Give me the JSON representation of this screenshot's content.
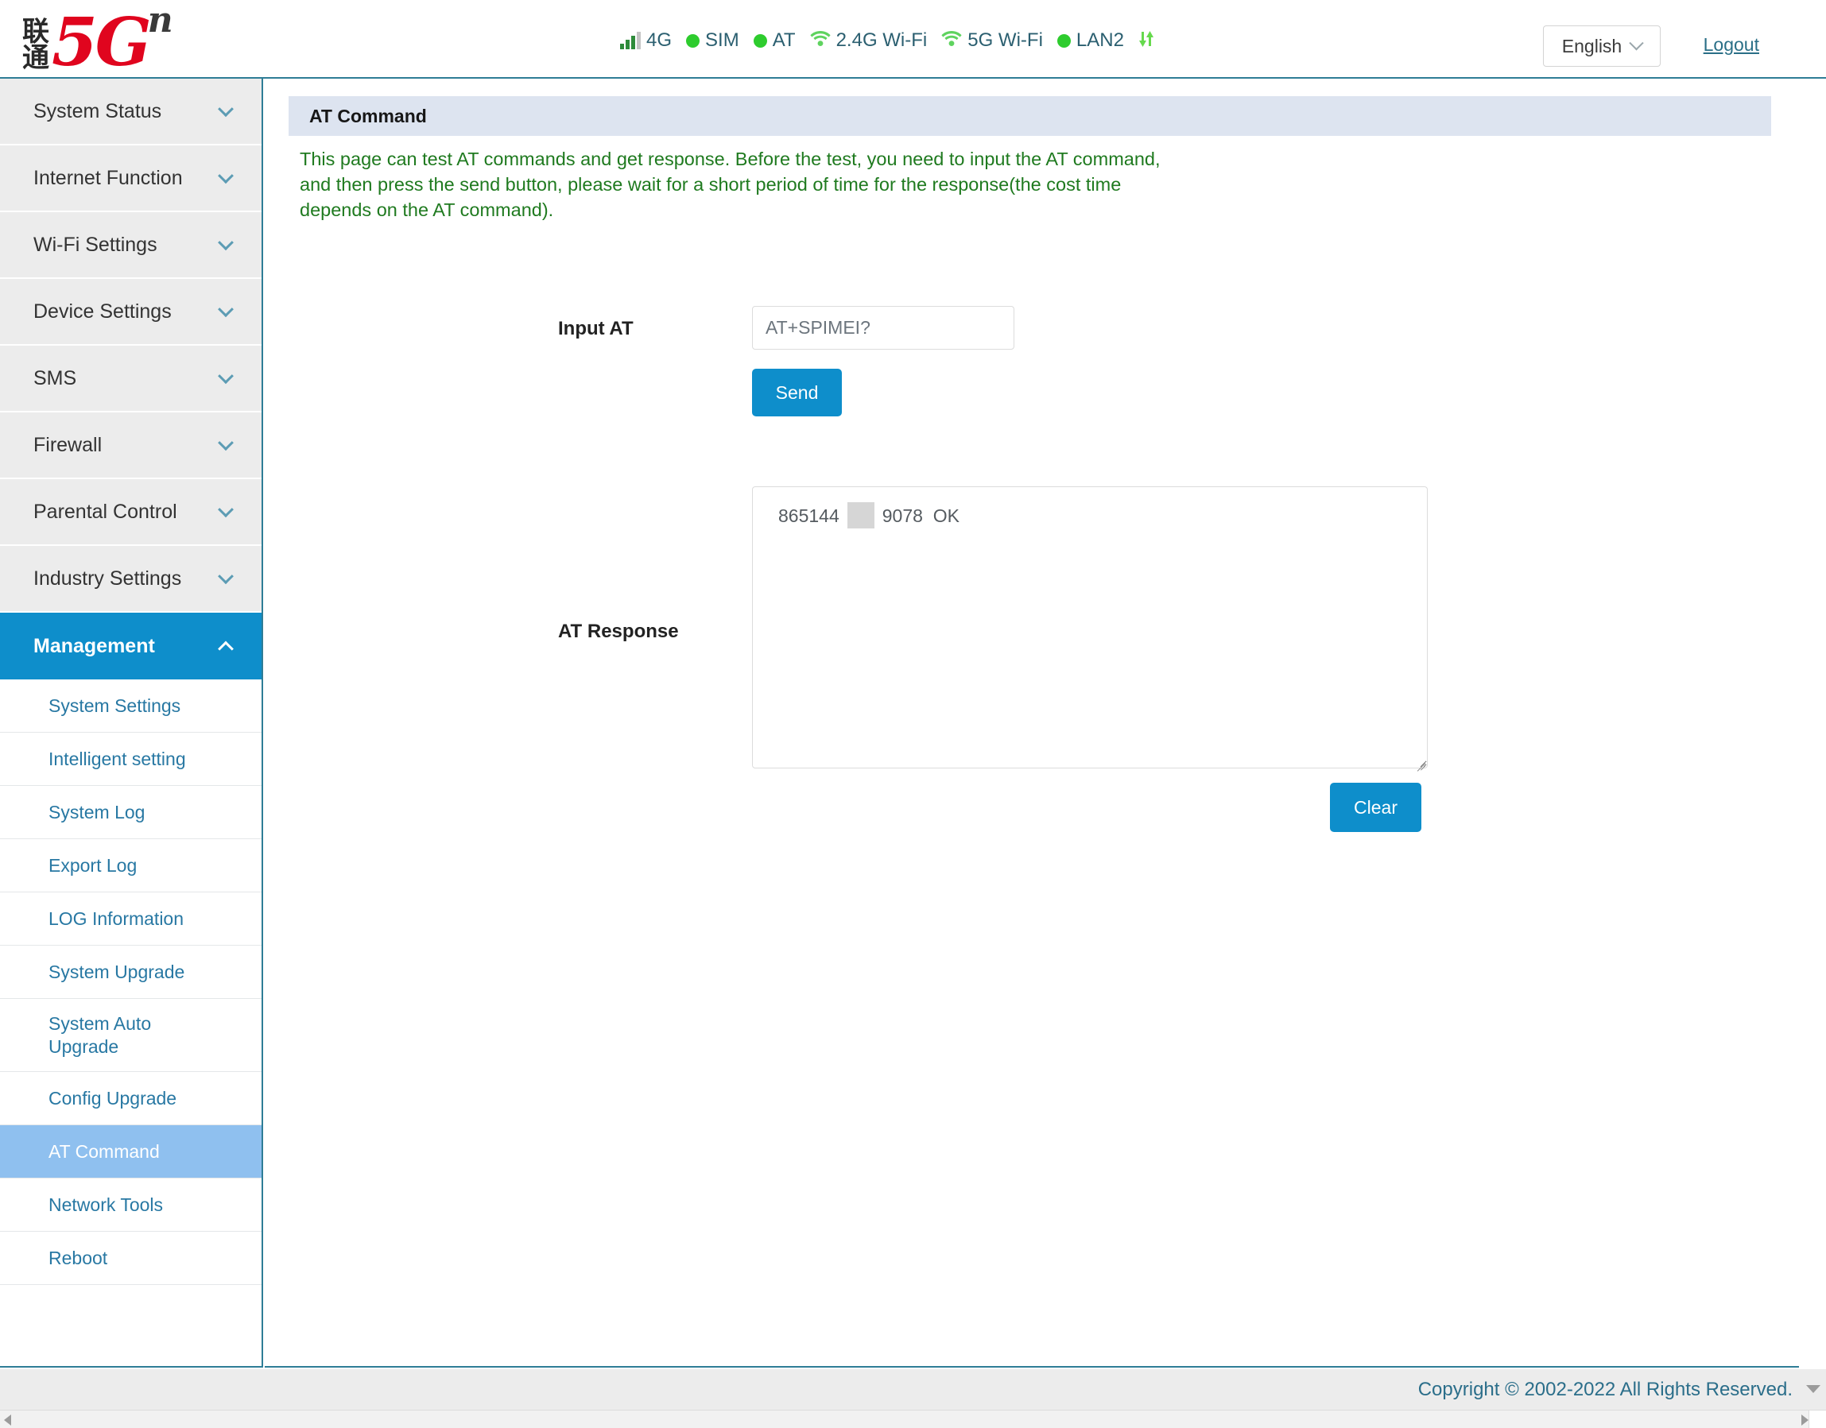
{
  "header": {
    "logo": {
      "cn_line1": "联",
      "cn_line2": "通",
      "brand": "5G",
      "sup": "n"
    },
    "status_items": [
      {
        "icon": "signal-bars-icon",
        "label": "4G"
      },
      {
        "icon": "green-dot-icon",
        "label": "SIM"
      },
      {
        "icon": "green-dot-icon",
        "label": "AT"
      },
      {
        "icon": "wifi-icon",
        "label": "2.4G Wi-Fi"
      },
      {
        "icon": "wifi-icon",
        "label": "5G Wi-Fi"
      },
      {
        "icon": "green-dot-icon",
        "label": "LAN2"
      },
      {
        "icon": "data-transfer-icon",
        "label": ""
      }
    ],
    "language": "English",
    "logout": "Logout"
  },
  "sidebar": {
    "top_items": [
      {
        "label": "System Status",
        "expanded": false
      },
      {
        "label": "Internet Function",
        "expanded": false
      },
      {
        "label": "Wi-Fi Settings",
        "expanded": false
      },
      {
        "label": "Device Settings",
        "expanded": false
      },
      {
        "label": "SMS",
        "expanded": false
      },
      {
        "label": "Firewall",
        "expanded": false
      },
      {
        "label": "Parental Control",
        "expanded": false
      },
      {
        "label": "Industry Settings",
        "expanded": false
      },
      {
        "label": "Management",
        "expanded": true
      }
    ],
    "sub_items": [
      {
        "label": "System Settings",
        "selected": false
      },
      {
        "label": "Intelligent setting",
        "selected": false
      },
      {
        "label": "System Log",
        "selected": false
      },
      {
        "label": "Export Log",
        "selected": false
      },
      {
        "label": "LOG Information",
        "selected": false
      },
      {
        "label": "System Upgrade",
        "selected": false
      },
      {
        "label": "System Auto Upgrade",
        "selected": false
      },
      {
        "label": "Config Upgrade",
        "selected": false
      },
      {
        "label": "AT Command",
        "selected": true
      },
      {
        "label": "Network Tools",
        "selected": false
      },
      {
        "label": "Reboot",
        "selected": false
      }
    ]
  },
  "main": {
    "panel_title": "AT Command",
    "description": "This page can test AT commands and get response. Before the test, you need to input the AT command, and then press the send button, please wait for a short period of time for the response(the cost time depends on the AT command).",
    "input_at_label": "Input AT",
    "input_at_value": "AT+SPIMEI?",
    "input_at_placeholder": "AT+SPIMEI?",
    "send_label": "Send",
    "at_response_label": "AT Response",
    "at_response_prefix": "865144",
    "at_response_suffix": "9078  OK",
    "clear_label": "Clear"
  },
  "footer": {
    "copyright": "Copyright © 2002-2022 All Rights Reserved."
  },
  "colors": {
    "accent_blue": "#0e8ecb",
    "selected_sub": "#8fc0ef",
    "status_green": "#2ecc2e",
    "desc_green": "#1f7a1f",
    "link_teal": "#2a6f87",
    "brand_red": "#e0051e",
    "panel_header": "#dde4f0"
  }
}
